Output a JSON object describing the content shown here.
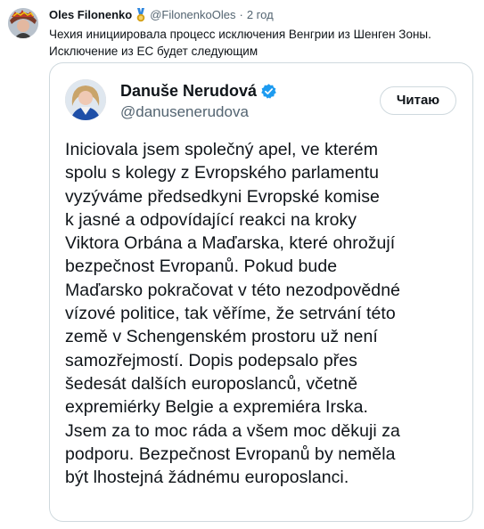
{
  "post": {
    "author_name": "Oles Filonenko",
    "author_handle": "@FilonenkoOles",
    "separator": "·",
    "time": "2 год",
    "text_lines": [
      "Чехия инициировала процесс исключения Венгрии из Шенген Зоны.",
      "Исключение из ЕС будет следующим"
    ]
  },
  "quoted": {
    "name": "Danuše Nerudová",
    "handle": "@danusenerudova",
    "follow_label": "Читаю",
    "text_lines": [
      "Iniciovala jsem společný apel, ve kterém",
      "spolu s kolegy z Evropského parlamentu",
      "vyzýváme předsedkyni Evropské komise",
      "k jasné a odpovídající reakci na kroky",
      "Viktora Orbána a Maďarska, které ohrožují",
      "bezpečnost Evropanů. Pokud bude",
      "Maďarsko pokračovat v této nezodpovědné",
      "vízové politice, tak věříme, že setrvání této",
      "země v Schengenském prostoru už není",
      "samozřejmostí. Dopis podepsalo přes",
      "šedesát dalších europoslanců, včetně",
      "expremiérky Belgie a expremiéra Irska.",
      "Jsem za to moc ráda a všem moc děkuji za",
      "podporu. Bezpečnost Evropanů by neměla",
      "být lhostejná žádnému europoslanci."
    ]
  },
  "colors": {
    "verified_badge": "#1d9bf0",
    "medal": "#d4a017",
    "secondary_text": "#536471",
    "border": "#cfd9de"
  }
}
